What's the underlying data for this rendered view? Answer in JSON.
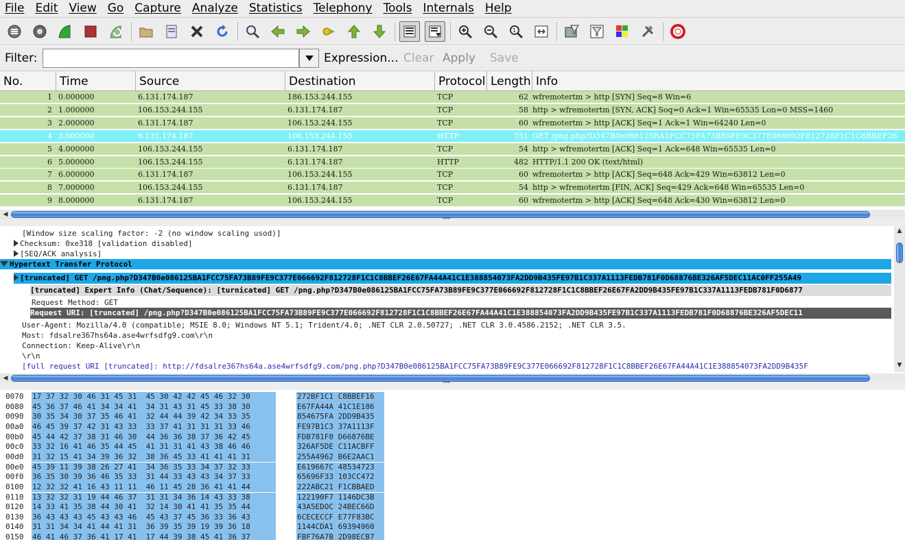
{
  "menu": [
    "File",
    "Edit",
    "View",
    "Go",
    "Capture",
    "Analyze",
    "Statistics",
    "Telephony",
    "Tools",
    "Internals",
    "Help"
  ],
  "toolbar_icons": [
    "interface-list-icon",
    "capture-options-icon",
    "start-capture-icon",
    "stop-capture-icon",
    "restart-capture-icon",
    "open-file-icon",
    "save-file-icon",
    "close-file-icon",
    "reload-icon",
    "find-packet-icon",
    "go-back-icon",
    "go-forward-icon",
    "go-to-packet-icon",
    "go-first-icon",
    "go-last-icon",
    "colorize-icon",
    "auto-scroll-icon",
    "zoom-in-icon",
    "zoom-out-icon",
    "normal-size-icon",
    "resize-columns-icon",
    "capture-filters-icon",
    "display-filters-icon",
    "coloring-rules-icon",
    "preferences-icon",
    "help-icon"
  ],
  "filter": {
    "label": "Filter:",
    "value": "",
    "expression": "Expression...",
    "clear": "Clear",
    "apply": "Apply",
    "save": "Save"
  },
  "columns": {
    "no": "No.",
    "time": "Time",
    "source": "Source",
    "destination": "Destination",
    "protocol": "Protocol",
    "length": "Length",
    "info": "Info"
  },
  "packets": [
    {
      "no": "1",
      "time": "0.000000",
      "source": "6.131.174.187",
      "destination": "186.153.244.155",
      "protocol": "TCP",
      "length": "62",
      "info": "wfremotertm > http [SYN] Seq=8 Win=6"
    },
    {
      "no": "2",
      "time": "1.000000",
      "source": "106.153.244.155",
      "destination": "6.131.174.187",
      "protocol": "TCP",
      "length": "58",
      "info": "http > wfremotertm [SYN, ACK] Soq=0 Ack=1 Win=65535 Lon=0 MSS=1460"
    },
    {
      "no": "3",
      "time": "2.000000",
      "source": "6.131.174.187",
      "destination": "106.153.244.155",
      "protocol": "TCP",
      "length": "60",
      "info": "wfremotertm > http [ACK] Seq=1 Ack=1  Win=64240 Len=0"
    },
    {
      "no": "4",
      "time": "3.000000",
      "source": "6.131.174.187",
      "destination": "106.153.244.155",
      "protocol": "HTTP",
      "length": "751",
      "info": "GET /png.php?D347B0e086125BA1FCC75FA73B89FE9C377E066692F812728F1C1C8BBEF26"
    },
    {
      "no": "5",
      "time": "4.000000",
      "source": "106.153.244.155",
      "destination": "6.131.174.187",
      "protocol": "TCP",
      "length": "54",
      "info": "http > wfremotertm [ACK] Seq=1 Ack=648 Win=65535 Len=0"
    },
    {
      "no": "6",
      "time": "5.000000",
      "source": "106.153.244.155",
      "destination": "6.131.174.187",
      "protocol": "HTTP",
      "length": "482",
      "info": "HTTP/1.1 200 OK (text/html)"
    },
    {
      "no": "7",
      "time": "6.000000",
      "source": "6.131.174.187",
      "destination": "106.153.244.155",
      "protocol": "TCP",
      "length": "60",
      "info": "wfremotertm > http [ACK] Seq=648 Ack=429 Win=63812 Len=0"
    },
    {
      "no": "8",
      "time": "7.000000",
      "source": "106.153.244.155",
      "destination": "6.131.174.187",
      "protocol": "TCP",
      "length": "54",
      "info": "http > wfremotertm [FIN, ACK] Seq=429 Ack=648 Win=65535 Len=0"
    },
    {
      "no": "9",
      "time": "8.000000",
      "source": "6.131.174.187",
      "destination": "106.153.244.155",
      "protocol": "TCP",
      "length": "60",
      "info": "wfremotertm > http [ACK] Seq=648 Ack=430 Win=63812 Len=0"
    }
  ],
  "selected_packet": "4",
  "colors": {
    "row_green": "#c5e0a8",
    "row_selected": "#7ff0f8",
    "tree_selected": "#1ea7e6",
    "tree_dark": "#5a5a5a",
    "hex_highlight": "#89c1ee"
  },
  "details": [
    {
      "indent": 32,
      "expander": "none",
      "text": "[Window size scaling factor: -2 (no window scaling usod)]",
      "style": "normal"
    },
    {
      "indent": 20,
      "expander": "closed",
      "text": "Checksum: 0xe318 [validation disabled]",
      "style": "normal"
    },
    {
      "indent": 20,
      "expander": "closed",
      "text": "[SEQ/ACK analysis]",
      "style": "normal"
    },
    {
      "indent": 4,
      "expander": "open",
      "text": "Hypertext Transfer Protocol",
      "style": "header"
    },
    {
      "indent": 20,
      "expander": "closed",
      "text": "[truncated]  GET /png.php?D347B0e086125BA1FCC75FA73B89FE9C377E066692F812728F1C1C8BBEF26E67FA44A41C1E388854073FA2DD9B435FE97B1C337A1113FEDB781F0D68876BE326AF5DEC11AC0FF255A49",
      "style": "selected"
    },
    {
      "indent": 44,
      "expander": "none",
      "text": "[truncated]  Expert Info (Chat/Sequence): [turnicated] GET /png.php?D347B0e086125BA1FCC75FA73B89FE9C377E066692F812728F1C1C8BBEF26E67FA2DD9B435FE97B1C337A1113FEDB781F0D6877",
      "style": "light"
    },
    {
      "indent": 46,
      "expander": "none",
      "text": "Request Method: GET",
      "style": "normal"
    },
    {
      "indent": 44,
      "expander": "none",
      "text": "Request URI: [truncated]  /png.php?D347B0e086125BA1FCC75FA73B89FE9C377E066692F812728F1C1C8BBEF26E67FA44A41C1E388854073FA2DD9B435FE97B1C337A1113FEDB781F0D68876BE326AF5DEC11",
      "style": "dark"
    },
    {
      "indent": 32,
      "expander": "none",
      "text": "User-Agent: Mozilla/4.0 (compatible; MSIE 8.0; Windows NT 5.1; Trident/4.0; .NET CLR 2.0.50727; .NET CLR 3.0.4586.2152; .NET CLR 3.5.",
      "style": "normal"
    },
    {
      "indent": 32,
      "expander": "none",
      "text": "Most: fdsalre367hs64a.ase4wrfsdfg9.com\\r\\n",
      "style": "normal"
    },
    {
      "indent": 32,
      "expander": "none",
      "text": "Connection: Keep-Alive\\r\\n",
      "style": "normal"
    },
    {
      "indent": 32,
      "expander": "none",
      "text": "\\r\\n",
      "style": "normal"
    },
    {
      "indent": 32,
      "expander": "none",
      "text": "[full request URI [truncated]: http://fdsalre367hs64a.ase4wrfsdfg9.com/png.php?D347B0e086125BA1FCC75FA73B89FE9C377E066692F812728F1C1C8BBEF26E67FA44A41C1E388854073FA2DD9B435F",
      "style": "link"
    }
  ],
  "hex": [
    {
      "offset": "0070",
      "bytes": "17 37 32 30 46 31 45 31  45 30 42 42 45 46 32 30",
      "ascii": "272BF1C1 C8BBEF16"
    },
    {
      "offset": "0080",
      "bytes": "45 36 37 46 41 34 34 41  34 31 43 31 45 33 38 30",
      "ascii": "E67FA44A 41C1E186"
    },
    {
      "offset": "0090",
      "bytes": "30 35 34 30 37 35 46 41  32 44 44 39 42 34 33 35",
      "ascii": "854675FA 2DD9B435"
    },
    {
      "offset": "00a0",
      "bytes": "46 45 39 37 42 31 43 33  33 37 41 31 31 31 33 46",
      "ascii": "FE97B1C3 37A1113F"
    },
    {
      "offset": "00b0",
      "bytes": "45 44 42 37 38 31 46 30  44 36 36 38 37 36 42 45",
      "ascii": "FDB781F0 D66876BE"
    },
    {
      "offset": "00c0",
      "bytes": "33 32 16 41 46 35 44 45  41 31 31 41 43 38 46 46",
      "ascii": "326AF5DE C11ACBFF"
    },
    {
      "offset": "00d0",
      "bytes": "31 32 15 41 34 39 36 32  38 36 45 33 41 41 41 31",
      "ascii": "255A4962 B6E2AAC1"
    },
    {
      "offset": "00e0",
      "bytes": "45 39 11 39 38 26 27 41  34 36 35 33 34 37 32 33",
      "ascii": "E619667C 48534723"
    },
    {
      "offset": "00f0",
      "bytes": "36 35 30 39 36 46 35 33  31 44 33 43 43 34 37 33",
      "ascii": "65696F33 103CC472"
    },
    {
      "offset": "0100",
      "bytes": "12 32 32 41 16 43 11 11  46 11 45 28 36 41 41 44",
      "ascii": "222ABC21 F1CBBAED"
    },
    {
      "offset": "0110",
      "bytes": "13 32 32 31 19 44 46 37  31 31 34 36 14 43 33 38",
      "ascii": "122190F7 1146DC3B"
    },
    {
      "offset": "0120",
      "bytes": "14 33 41 35 38 44 30 41  32 14 30 41 41 35 35 44",
      "ascii": "43A5EDOC 24BEC66D"
    },
    {
      "offset": "0130",
      "bytes": "36 43 43 43 45 43 43 46  45 43 37 45 36 33 36 43",
      "ascii": "6CECECCF E77F83BC"
    },
    {
      "offset": "0140",
      "bytes": "31 31 34 34 41 44 41 31  36 39 35 39 19 39 36 18",
      "ascii": "1144CDA1 69394960"
    },
    {
      "offset": "0150",
      "bytes": "46 41 46 37 36 41 17 41  17 44 39 38 45 41 36 37",
      "ascii": "FBF76A7B 2D98ECB7"
    }
  ]
}
